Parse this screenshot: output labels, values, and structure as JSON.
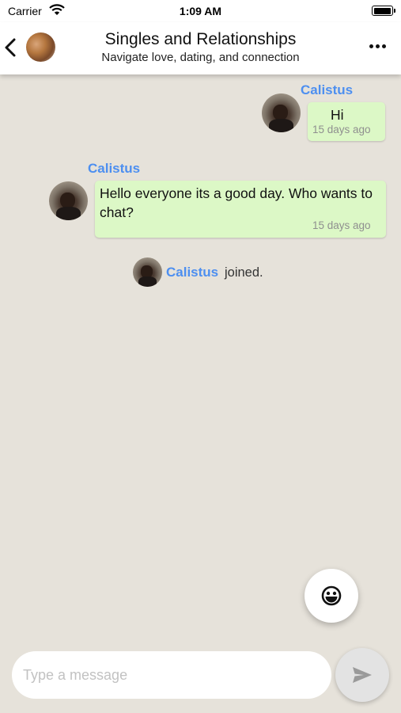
{
  "status_bar": {
    "carrier": "Carrier",
    "time": "1:09 AM",
    "battery_level": 0.9
  },
  "header": {
    "title": "Singles and Relationships",
    "subtitle": "Navigate love, dating, and connection",
    "icons": {
      "back": "chevron-left-icon",
      "more": "more-horizontal-icon"
    }
  },
  "messages": [
    {
      "sender": "Calistus",
      "text": "Hi",
      "time": "15 days ago"
    },
    {
      "sender": "Calistus",
      "text": "Hello everyone its a good day. Who wants to chat?",
      "time": "15 days ago"
    }
  ],
  "system": {
    "joined_name": "Calistus",
    "joined_text": "joined."
  },
  "composer": {
    "placeholder": "Type a message",
    "value": "",
    "fab_icon": "emoji-face-icon",
    "send_icon": "send-icon"
  },
  "colors": {
    "accent": "#4d8ff0",
    "bubble": "#dcf8c6",
    "background": "#e6e2da"
  }
}
